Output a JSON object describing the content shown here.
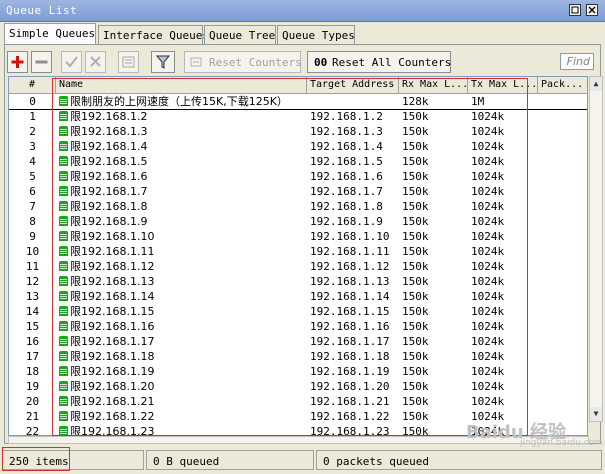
{
  "window": {
    "title": "Queue List"
  },
  "tabs": [
    {
      "label": "Simple Queues",
      "active": true
    },
    {
      "label": "Interface Queues",
      "active": false
    },
    {
      "label": "Queue Tree",
      "active": false
    },
    {
      "label": "Queue Types",
      "active": false
    }
  ],
  "toolbar": {
    "add_icon": "plus-icon",
    "remove_icon": "minus-icon",
    "enable_icon": "check-icon",
    "disable_icon": "x-icon",
    "comment_icon": "note-icon",
    "filter_icon": "filter-icon",
    "reset_counters": "Reset Counters",
    "reset_all_prefix": "00",
    "reset_all_counters": "Reset All Counters",
    "find_placeholder": "Find"
  },
  "columns": {
    "index": "#",
    "name": "Name",
    "target": "Target Address",
    "rx": "Rx Max L...",
    "tx": "Tx Max L...",
    "pack": "Pack..."
  },
  "rows": [
    {
      "idx": "0",
      "name": "限制朋友的上网速度（上传15K,下载125K）",
      "target": "",
      "rx": "128k",
      "tx": "1M"
    },
    {
      "idx": "1",
      "name": "限192.168.1.2",
      "target": "192.168.1.2",
      "rx": "150k",
      "tx": "1024k"
    },
    {
      "idx": "2",
      "name": "限192.168.1.3",
      "target": "192.168.1.3",
      "rx": "150k",
      "tx": "1024k"
    },
    {
      "idx": "3",
      "name": "限192.168.1.4",
      "target": "192.168.1.4",
      "rx": "150k",
      "tx": "1024k"
    },
    {
      "idx": "4",
      "name": "限192.168.1.5",
      "target": "192.168.1.5",
      "rx": "150k",
      "tx": "1024k"
    },
    {
      "idx": "5",
      "name": "限192.168.1.6",
      "target": "192.168.1.6",
      "rx": "150k",
      "tx": "1024k"
    },
    {
      "idx": "6",
      "name": "限192.168.1.7",
      "target": "192.168.1.7",
      "rx": "150k",
      "tx": "1024k"
    },
    {
      "idx": "7",
      "name": "限192.168.1.8",
      "target": "192.168.1.8",
      "rx": "150k",
      "tx": "1024k"
    },
    {
      "idx": "8",
      "name": "限192.168.1.9",
      "target": "192.168.1.9",
      "rx": "150k",
      "tx": "1024k"
    },
    {
      "idx": "9",
      "name": "限192.168.1.10",
      "target": "192.168.1.10",
      "rx": "150k",
      "tx": "1024k"
    },
    {
      "idx": "10",
      "name": "限192.168.1.11",
      "target": "192.168.1.11",
      "rx": "150k",
      "tx": "1024k"
    },
    {
      "idx": "11",
      "name": "限192.168.1.12",
      "target": "192.168.1.12",
      "rx": "150k",
      "tx": "1024k"
    },
    {
      "idx": "12",
      "name": "限192.168.1.13",
      "target": "192.168.1.13",
      "rx": "150k",
      "tx": "1024k"
    },
    {
      "idx": "13",
      "name": "限192.168.1.14",
      "target": "192.168.1.14",
      "rx": "150k",
      "tx": "1024k"
    },
    {
      "idx": "14",
      "name": "限192.168.1.15",
      "target": "192.168.1.15",
      "rx": "150k",
      "tx": "1024k"
    },
    {
      "idx": "15",
      "name": "限192.168.1.16",
      "target": "192.168.1.16",
      "rx": "150k",
      "tx": "1024k"
    },
    {
      "idx": "16",
      "name": "限192.168.1.17",
      "target": "192.168.1.17",
      "rx": "150k",
      "tx": "1024k"
    },
    {
      "idx": "17",
      "name": "限192.168.1.18",
      "target": "192.168.1.18",
      "rx": "150k",
      "tx": "1024k"
    },
    {
      "idx": "18",
      "name": "限192.168.1.19",
      "target": "192.168.1.19",
      "rx": "150k",
      "tx": "1024k"
    },
    {
      "idx": "19",
      "name": "限192.168.1.20",
      "target": "192.168.1.20",
      "rx": "150k",
      "tx": "1024k"
    },
    {
      "idx": "20",
      "name": "限192.168.1.21",
      "target": "192.168.1.21",
      "rx": "150k",
      "tx": "1024k"
    },
    {
      "idx": "21",
      "name": "限192.168.1.22",
      "target": "192.168.1.22",
      "rx": "150k",
      "tx": "1024k"
    },
    {
      "idx": "22",
      "name": "限192.168.1.23",
      "target": "192.168.1.23",
      "rx": "150k",
      "tx": "1024k"
    }
  ],
  "status": {
    "items": "250 items",
    "bytes": "0 B queued",
    "packets": "0 packets queued"
  },
  "watermark": {
    "main": "Baidu 经验",
    "sub": "jingyan.baidu.com"
  }
}
